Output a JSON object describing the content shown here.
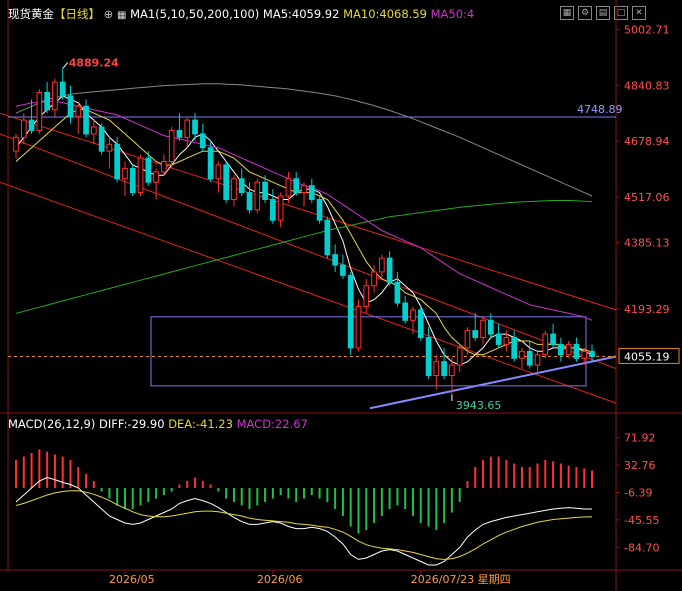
{
  "header": {
    "symbol": "现货黄金",
    "period": "【日线】",
    "ma_params": "MA1(5,10,50,200,100)",
    "ma5": "MA5:4059.92",
    "ma10": "MA10:4068.59",
    "ma50": "MA50:4"
  },
  "macd_header": {
    "params": "MACD(26,12,9)",
    "diff": "DIFF:-29.90",
    "dea": "DEA:-41.23",
    "macd": "MACD:22.67"
  },
  "toolbar_icons": [
    "grid-icon",
    "settings-icon",
    "pin-icon",
    "window-icon",
    "close-icon"
  ],
  "annotations": {
    "high_label": "4889.24",
    "low_label": "3943.65",
    "hline_label": "4748.89",
    "last_price": "4055.19"
  },
  "chart_data": [
    {
      "type": "candlestick",
      "title": "现货黄金【日线】",
      "y_ticks": [
        "5002.71",
        "4840.83",
        "4678.94",
        "4517.06",
        "4385.13",
        "4193.29",
        "4055.19"
      ],
      "ylim": [
        3900,
        5030
      ],
      "x_ticks": [
        "2026/05",
        "2026/06",
        "2026/07/23 星期四"
      ],
      "high": 4889.24,
      "low": 3943.65,
      "horizontal_line": 4748.89,
      "last_price": 4055.19,
      "candles": [
        [
          4650,
          4700,
          4630,
          4690
        ],
        [
          4690,
          4760,
          4670,
          4740
        ],
        [
          4740,
          4800,
          4700,
          4710
        ],
        [
          4710,
          4830,
          4700,
          4820
        ],
        [
          4820,
          4850,
          4760,
          4770
        ],
        [
          4770,
          4860,
          4750,
          4850
        ],
        [
          4850,
          4889,
          4800,
          4810
        ],
        [
          4810,
          4840,
          4730,
          4750
        ],
        [
          4750,
          4790,
          4700,
          4780
        ],
        [
          4780,
          4800,
          4690,
          4700
        ],
        [
          4700,
          4740,
          4670,
          4720
        ],
        [
          4720,
          4730,
          4640,
          4650
        ],
        [
          4650,
          4690,
          4600,
          4670
        ],
        [
          4670,
          4690,
          4560,
          4570
        ],
        [
          4570,
          4620,
          4520,
          4600
        ],
        [
          4600,
          4610,
          4520,
          4530
        ],
        [
          4530,
          4640,
          4520,
          4630
        ],
        [
          4630,
          4650,
          4550,
          4560
        ],
        [
          4560,
          4600,
          4510,
          4590
        ],
        [
          4590,
          4640,
          4580,
          4620
        ],
        [
          4620,
          4720,
          4600,
          4710
        ],
        [
          4710,
          4760,
          4680,
          4690
        ],
        [
          4690,
          4750,
          4660,
          4740
        ],
        [
          4740,
          4760,
          4680,
          4700
        ],
        [
          4700,
          4730,
          4650,
          4660
        ],
        [
          4660,
          4680,
          4560,
          4570
        ],
        [
          4570,
          4620,
          4530,
          4610
        ],
        [
          4610,
          4620,
          4500,
          4510
        ],
        [
          4510,
          4580,
          4490,
          4570
        ],
        [
          4570,
          4600,
          4520,
          4530
        ],
        [
          4530,
          4560,
          4470,
          4480
        ],
        [
          4480,
          4570,
          4470,
          4560
        ],
        [
          4560,
          4580,
          4500,
          4510
        ],
        [
          4510,
          4540,
          4440,
          4450
        ],
        [
          4450,
          4530,
          4430,
          4520
        ],
        [
          4520,
          4590,
          4500,
          4570
        ],
        [
          4570,
          4590,
          4520,
          4530
        ],
        [
          4530,
          4560,
          4490,
          4550
        ],
        [
          4550,
          4570,
          4500,
          4510
        ],
        [
          4510,
          4520,
          4440,
          4450
        ],
        [
          4450,
          4460,
          4340,
          4350
        ],
        [
          4350,
          4380,
          4300,
          4320
        ],
        [
          4320,
          4350,
          4280,
          4290
        ],
        [
          4290,
          4300,
          4060,
          4080
        ],
        [
          4080,
          4220,
          4070,
          4200
        ],
        [
          4200,
          4280,
          4180,
          4260
        ],
        [
          4260,
          4320,
          4240,
          4300
        ],
        [
          4300,
          4350,
          4280,
          4340
        ],
        [
          4340,
          4360,
          4260,
          4270
        ],
        [
          4270,
          4300,
          4200,
          4210
        ],
        [
          4210,
          4230,
          4150,
          4160
        ],
        [
          4160,
          4200,
          4120,
          4190
        ],
        [
          4190,
          4200,
          4100,
          4110
        ],
        [
          4110,
          4140,
          3990,
          4000
        ],
        [
          4000,
          4060,
          3960,
          4040
        ],
        [
          4040,
          4080,
          3990,
          4000
        ],
        [
          4000,
          4050,
          3943,
          4030
        ],
        [
          4030,
          4090,
          4010,
          4080
        ],
        [
          4080,
          4140,
          4060,
          4130
        ],
        [
          4130,
          4180,
          4100,
          4110
        ],
        [
          4110,
          4170,
          4090,
          4160
        ],
        [
          4160,
          4180,
          4110,
          4120
        ],
        [
          4120,
          4150,
          4080,
          4090
        ],
        [
          4090,
          4130,
          4070,
          4110
        ],
        [
          4110,
          4130,
          4040,
          4050
        ],
        [
          4050,
          4080,
          4020,
          4070
        ],
        [
          4070,
          4100,
          4020,
          4030
        ],
        [
          4030,
          4070,
          4000,
          4060
        ],
        [
          4060,
          4130,
          4050,
          4120
        ],
        [
          4120,
          4150,
          4080,
          4090
        ],
        [
          4090,
          4110,
          4040,
          4060
        ],
        [
          4060,
          4100,
          4050,
          4090
        ],
        [
          4090,
          4110,
          4040,
          4050
        ],
        [
          4050,
          4080,
          4030,
          4070
        ],
        [
          4070,
          4090,
          4040,
          4055
        ]
      ],
      "ma_series": [
        {
          "name": "MA5",
          "color": "#ffffff",
          "values": [
            4660,
            4690,
            4720,
            4750,
            4770,
            4790,
            4810,
            4800,
            4790,
            4760,
            4740,
            4720,
            4690,
            4670,
            4640,
            4610,
            4600,
            4590,
            4580,
            4580,
            4610,
            4640,
            4660,
            4690,
            4700,
            4680,
            4650,
            4620,
            4590,
            4560,
            4540,
            4530,
            4530,
            4520,
            4510,
            4510,
            4530,
            4540,
            4540,
            4530,
            4490,
            4440,
            4390,
            4310,
            4250,
            4210,
            4220,
            4240,
            4270,
            4280,
            4260,
            4240,
            4200,
            4150,
            4100,
            4060,
            4040,
            4030,
            4040,
            4060,
            4080,
            4110,
            4120,
            4120,
            4110,
            4100,
            4080,
            4070,
            4070,
            4080,
            4080,
            4080,
            4080,
            4070,
            4060
          ]
        },
        {
          "name": "MA10",
          "color": "#e6d83a",
          "values": [
            4620,
            4640,
            4660,
            4680,
            4700,
            4720,
            4740,
            4760,
            4770,
            4770,
            4760,
            4750,
            4740,
            4720,
            4700,
            4680,
            4660,
            4640,
            4620,
            4610,
            4610,
            4620,
            4630,
            4640,
            4650,
            4650,
            4650,
            4640,
            4630,
            4610,
            4590,
            4580,
            4570,
            4560,
            4550,
            4540,
            4530,
            4530,
            4530,
            4520,
            4510,
            4480,
            4450,
            4410,
            4370,
            4330,
            4300,
            4280,
            4270,
            4260,
            4240,
            4230,
            4220,
            4200,
            4180,
            4140,
            4110,
            4090,
            4070,
            4060,
            4060,
            4070,
            4080,
            4090,
            4100,
            4100,
            4100,
            4090,
            4090,
            4090,
            4090,
            4080,
            4080,
            4075,
            4068
          ]
        },
        {
          "name": "MA50",
          "color": "#cc33cc",
          "values": [
            4780,
            4785,
            4790,
            4790,
            4795,
            4795,
            4790,
            4785,
            4780,
            4775,
            4770,
            4765,
            4760,
            4755,
            4745,
            4735,
            4725,
            4715,
            4705,
            4695,
            4690,
            4685,
            4680,
            4675,
            4670,
            4665,
            4660,
            4650,
            4640,
            4630,
            4620,
            4610,
            4600,
            4590,
            4580,
            4570,
            4560,
            4550,
            4545,
            4535,
            4525,
            4510,
            4495,
            4480,
            4465,
            4450,
            4435,
            4420,
            4410,
            4400,
            4390,
            4380,
            4370,
            4355,
            4340,
            4325,
            4310,
            4295,
            4285,
            4275,
            4265,
            4255,
            4245,
            4235,
            4225,
            4215,
            4205,
            4200,
            4195,
            4190,
            4185,
            4180,
            4175,
            4170,
            4160
          ]
        },
        {
          "name": "MA200",
          "color": "#22aa22",
          "values": [
            4180,
            4186,
            4192,
            4198,
            4204,
            4210,
            4216,
            4222,
            4228,
            4234,
            4240,
            4246,
            4252,
            4258,
            4264,
            4270,
            4276,
            4282,
            4288,
            4294,
            4300,
            4306,
            4312,
            4318,
            4324,
            4330,
            4336,
            4342,
            4348,
            4354,
            4360,
            4366,
            4372,
            4378,
            4384,
            4390,
            4396,
            4402,
            4408,
            4414,
            4420,
            4425,
            4430,
            4435,
            4440,
            4445,
            4450,
            4455,
            4460,
            4463,
            4466,
            4469,
            4472,
            4475,
            4478,
            4481,
            4484,
            4487,
            4490,
            4492,
            4494,
            4496,
            4498,
            4500,
            4502,
            4503,
            4504,
            4505,
            4506,
            4507,
            4507,
            4507,
            4506,
            4505,
            4504
          ]
        },
        {
          "name": "MA100",
          "color": "#888888",
          "values": [
            4760,
            4770,
            4780,
            4790,
            4800,
            4805,
            4810,
            4815,
            4818,
            4820,
            4822,
            4824,
            4826,
            4828,
            4830,
            4832,
            4834,
            4836,
            4838,
            4840,
            4841,
            4842,
            4843,
            4844,
            4845,
            4845,
            4845,
            4844,
            4843,
            4842,
            4840,
            4838,
            4836,
            4834,
            4832,
            4830,
            4827,
            4824,
            4821,
            4818,
            4814,
            4810,
            4805,
            4800,
            4794,
            4788,
            4782,
            4775,
            4768,
            4760,
            4752,
            4744,
            4735,
            4726,
            4717,
            4708,
            4699,
            4690,
            4680,
            4670,
            4660,
            4650,
            4640,
            4630,
            4620,
            4610,
            4600,
            4590,
            4580,
            4570,
            4560,
            4550,
            4540,
            4530,
            4520
          ]
        }
      ]
    },
    {
      "type": "macd",
      "title": "MACD(26,12,9)",
      "y_ticks": [
        "71.92",
        "32.76",
        "-6.39",
        "-45.55",
        "-84.70"
      ],
      "ylim": [
        -110,
        90
      ],
      "diff": -29.9,
      "dea": -41.23,
      "macd": 22.67,
      "histogram": [
        40,
        45,
        50,
        55,
        52,
        48,
        45,
        40,
        30,
        20,
        10,
        -5,
        -15,
        -25,
        -30,
        -30,
        -25,
        -20,
        -15,
        -10,
        -5,
        5,
        10,
        15,
        10,
        5,
        -5,
        -15,
        -20,
        -25,
        -30,
        -25,
        -20,
        -15,
        -10,
        -15,
        -20,
        -15,
        -10,
        -15,
        -20,
        -30,
        -40,
        -55,
        -65,
        -60,
        -50,
        -40,
        -30,
        -25,
        -30,
        -40,
        -50,
        -55,
        -60,
        -50,
        -35,
        -20,
        10,
        30,
        40,
        45,
        45,
        40,
        35,
        30,
        30,
        35,
        40,
        38,
        35,
        32,
        30,
        28,
        25
      ],
      "diff_series": [
        -20,
        -10,
        0,
        10,
        15,
        12,
        8,
        5,
        0,
        -10,
        -20,
        -30,
        -40,
        -45,
        -50,
        -52,
        -50,
        -45,
        -40,
        -35,
        -30,
        -22,
        -18,
        -15,
        -18,
        -22,
        -28,
        -35,
        -42,
        -48,
        -52,
        -52,
        -50,
        -48,
        -50,
        -55,
        -58,
        -58,
        -56,
        -58,
        -62,
        -70,
        -80,
        -95,
        -102,
        -100,
        -95,
        -90,
        -88,
        -90,
        -95,
        -100,
        -105,
        -110,
        -110,
        -105,
        -95,
        -85,
        -70,
        -60,
        -52,
        -48,
        -45,
        -42,
        -40,
        -38,
        -36,
        -34,
        -32,
        -30,
        -29,
        -28,
        -29,
        -30,
        -30
      ],
      "dea_series": [
        -25,
        -22,
        -18,
        -14,
        -10,
        -7,
        -5,
        -4,
        -4,
        -6,
        -9,
        -13,
        -18,
        -24,
        -29,
        -34,
        -38,
        -40,
        -41,
        -41,
        -40,
        -38,
        -36,
        -34,
        -33,
        -33,
        -34,
        -36,
        -38,
        -40,
        -43,
        -45,
        -46,
        -47,
        -48,
        -49,
        -51,
        -52,
        -53,
        -55,
        -56,
        -59,
        -63,
        -69,
        -76,
        -81,
        -84,
        -86,
        -87,
        -88,
        -90,
        -92,
        -95,
        -98,
        -101,
        -102,
        -101,
        -98,
        -93,
        -87,
        -80,
        -74,
        -68,
        -63,
        -59,
        -55,
        -52,
        -49,
        -47,
        -45,
        -44,
        -43,
        -42,
        -41.5,
        -41.2
      ]
    }
  ]
}
